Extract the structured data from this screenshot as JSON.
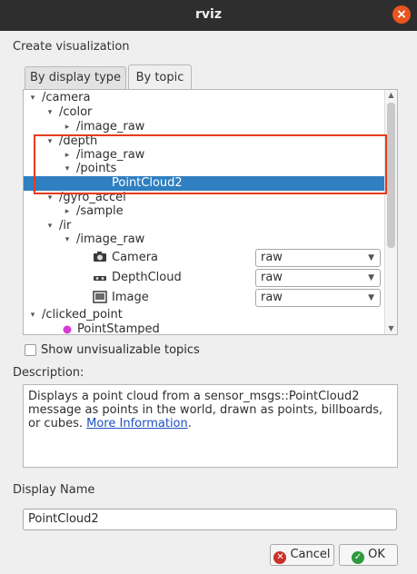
{
  "window": {
    "title": "rviz",
    "close_glyph": "×"
  },
  "labels": {
    "create_visualization": "Create visualization",
    "description": "Description:",
    "display_name": "Display Name",
    "show_unvisualizable": "Show unvisualizable topics"
  },
  "tabs": [
    {
      "label": "By display type",
      "active": false
    },
    {
      "label": "By topic",
      "active": true
    }
  ],
  "tree": [
    {
      "text": "/camera",
      "arrow": "▾"
    },
    {
      "text": "/color",
      "arrow": "▾"
    },
    {
      "text": "/image_raw",
      "arrow": "▸"
    },
    {
      "text": "/depth",
      "arrow": "▾"
    },
    {
      "text": "/image_raw",
      "arrow": "▸"
    },
    {
      "text": "/points",
      "arrow": "▾"
    },
    {
      "text": "PointCloud2",
      "selected": true
    },
    {
      "text": "/gyro_accel",
      "arrow": "▾"
    },
    {
      "text": "/sample",
      "arrow": "▸"
    },
    {
      "text": "/ir",
      "arrow": "▾"
    },
    {
      "text": "/image_raw",
      "arrow": "▾"
    },
    {
      "text": "Camera",
      "icon": "camera-icon",
      "combo": "raw"
    },
    {
      "text": "DepthCloud",
      "icon": "depthcloud-icon",
      "combo": "raw"
    },
    {
      "text": "Image",
      "icon": "image-icon",
      "combo": "raw"
    },
    {
      "text": "/clicked_point",
      "arrow": "▾"
    },
    {
      "text": "PointStamped",
      "icon": "point-stamped-icon"
    }
  ],
  "description": {
    "text": "Displays a point cloud from a sensor_msgs::PointCloud2 message as points in the world, drawn as points, billboards, or cubes.",
    "link_more": "More",
    "link_information": "Information",
    "suffix": "."
  },
  "display_name_value": "PointCloud2",
  "buttons": {
    "cancel": "Cancel",
    "ok": "OK"
  },
  "colors": {
    "selection": "#2f7fc1",
    "highlight_box": "#e53b1f",
    "close_button": "#e95420"
  }
}
